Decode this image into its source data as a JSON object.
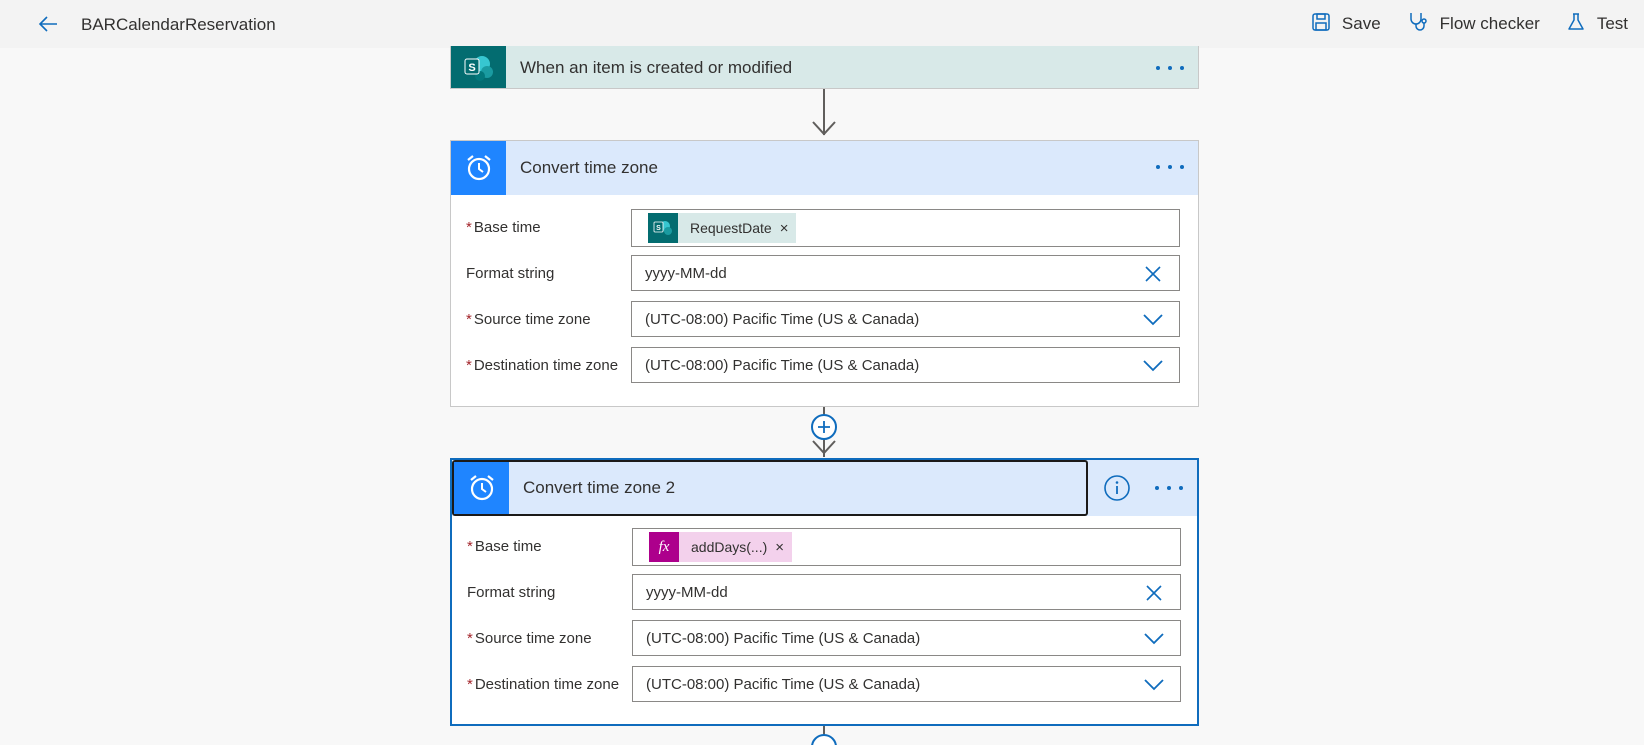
{
  "header": {
    "title": "BARCalendarReservation",
    "back_icon": "back-arrow-icon",
    "actions": [
      {
        "label": "Save",
        "icon": "save-icon"
      },
      {
        "label": "Flow checker",
        "icon": "stethoscope-icon"
      },
      {
        "label": "Test",
        "icon": "flask-icon"
      }
    ]
  },
  "colors": {
    "sharepoint": "#036c70",
    "sharepoint_header_bg": "#d8e9e8",
    "schedule_icon_bg": "#1f85ff",
    "schedule_header_bg": "#dbe9fc",
    "expression_icon_bg": "#ad008c",
    "expression_token_bg": "#f3d1ec",
    "accent": "#0f6cbd"
  },
  "trigger": {
    "title": "When an item is created or modified",
    "icon": "sharepoint-icon"
  },
  "step1": {
    "title": "Convert time zone",
    "icon": "alarm-clock-icon",
    "fields": {
      "base_time_label": "Base time",
      "base_time_token": "RequestDate",
      "format_label": "Format string",
      "format_value": "yyyy-MM-dd",
      "source_label": "Source time zone",
      "source_value": "(UTC-08:00) Pacific Time (US & Canada)",
      "dest_label": "Destination time zone",
      "dest_value": "(UTC-08:00) Pacific Time (US & Canada)"
    }
  },
  "step2": {
    "title": "Convert time zone 2",
    "icon": "alarm-clock-icon",
    "fields": {
      "base_time_label": "Base time",
      "base_time_token": "addDays(...)",
      "format_label": "Format string",
      "format_value": "yyyy-MM-dd",
      "source_label": "Source time zone",
      "source_value": "(UTC-08:00) Pacific Time (US & Canada)",
      "dest_label": "Destination time zone",
      "dest_value": "(UTC-08:00) Pacific Time (US & Canada)"
    }
  },
  "token_remove": "×",
  "required_mark": "*",
  "expression_glyph": "fx"
}
